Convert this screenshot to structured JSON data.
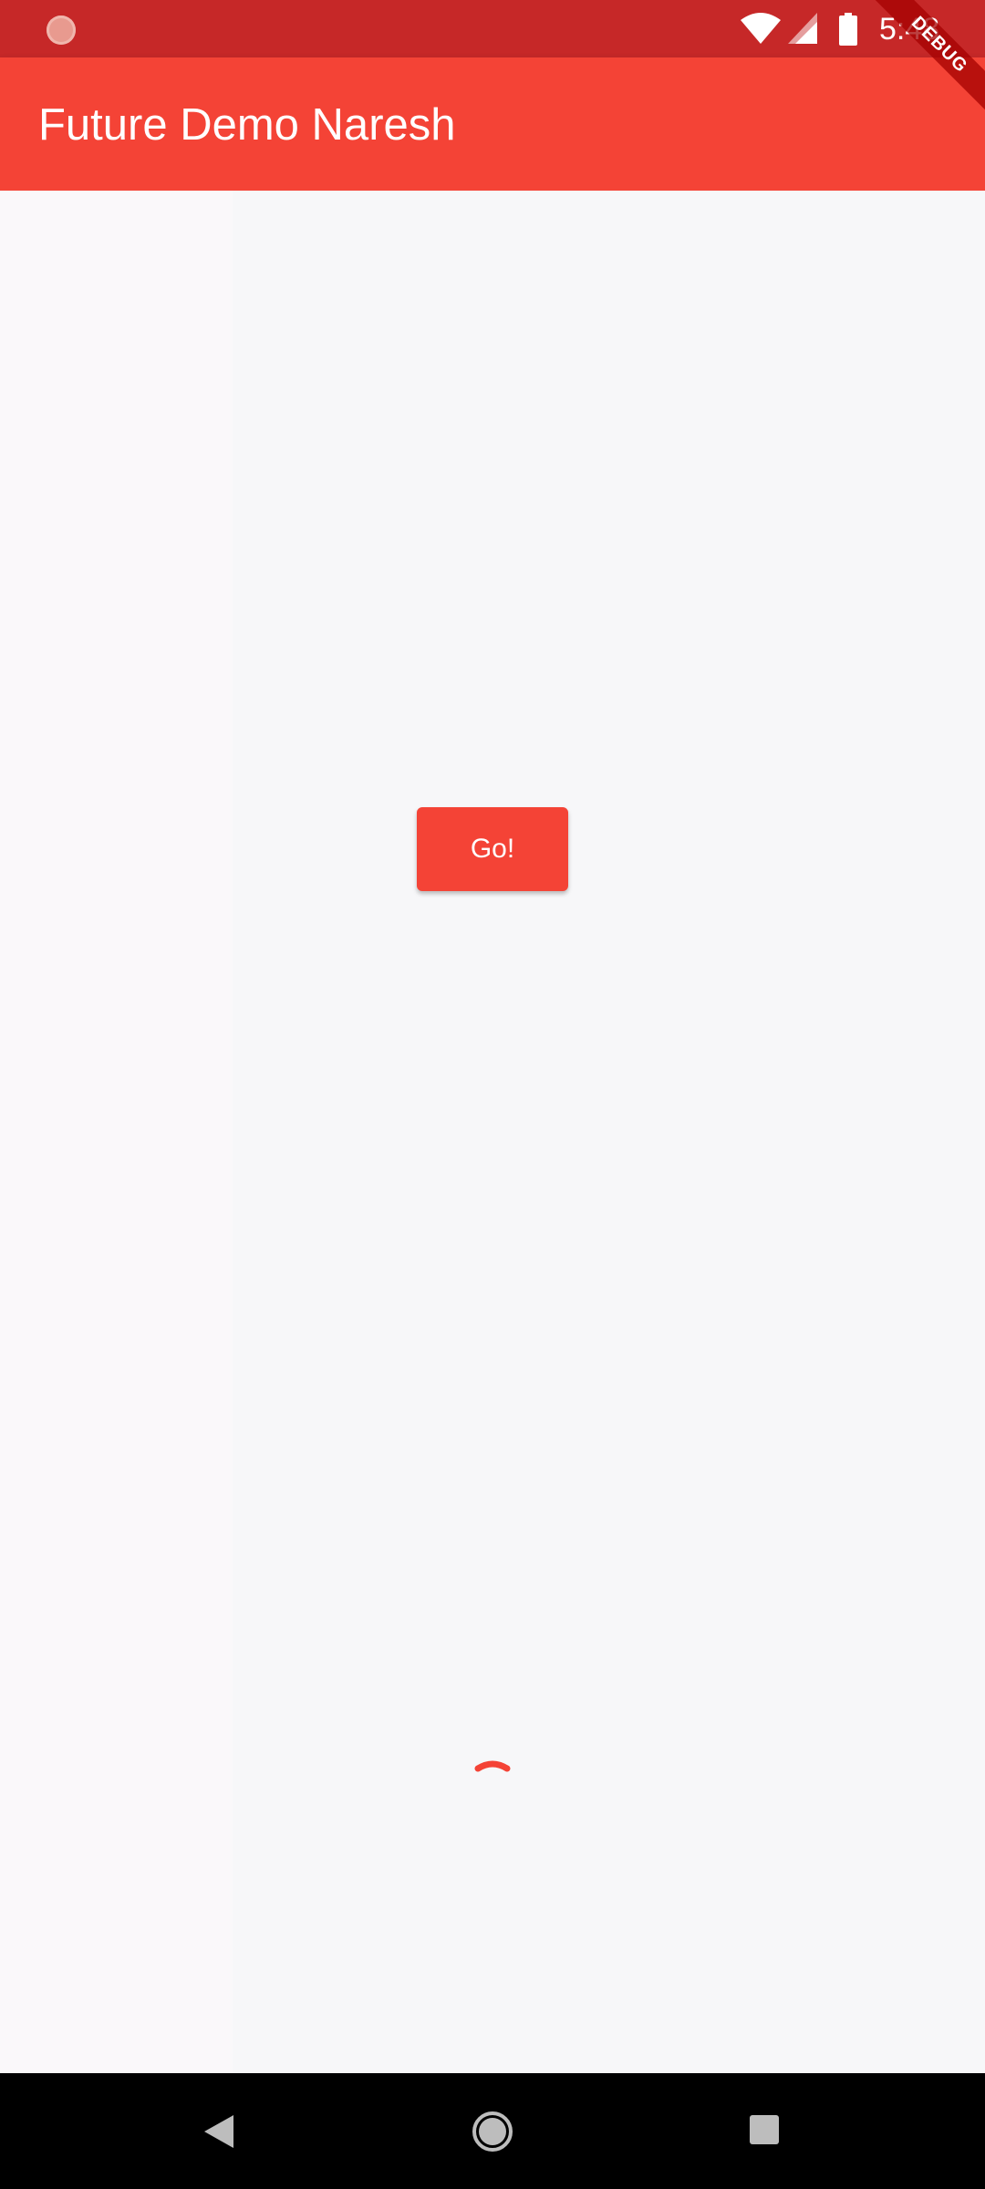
{
  "status_bar": {
    "time": "5:48",
    "icons": [
      "record-dot-icon",
      "wifi-icon",
      "signal-icon",
      "battery-icon"
    ]
  },
  "app_bar": {
    "title": "Future Demo Naresh",
    "color": "#f44336"
  },
  "debug_banner": {
    "label": "DEBUG"
  },
  "main": {
    "button_label": "Go!",
    "loading_indicator": "circular-progress-icon"
  },
  "nav_bar": {
    "icons": [
      "back-icon",
      "home-icon",
      "recents-icon"
    ]
  },
  "colors": {
    "status_bar": "#c62828",
    "accent": "#f44336",
    "background": "#f7f7f9"
  }
}
